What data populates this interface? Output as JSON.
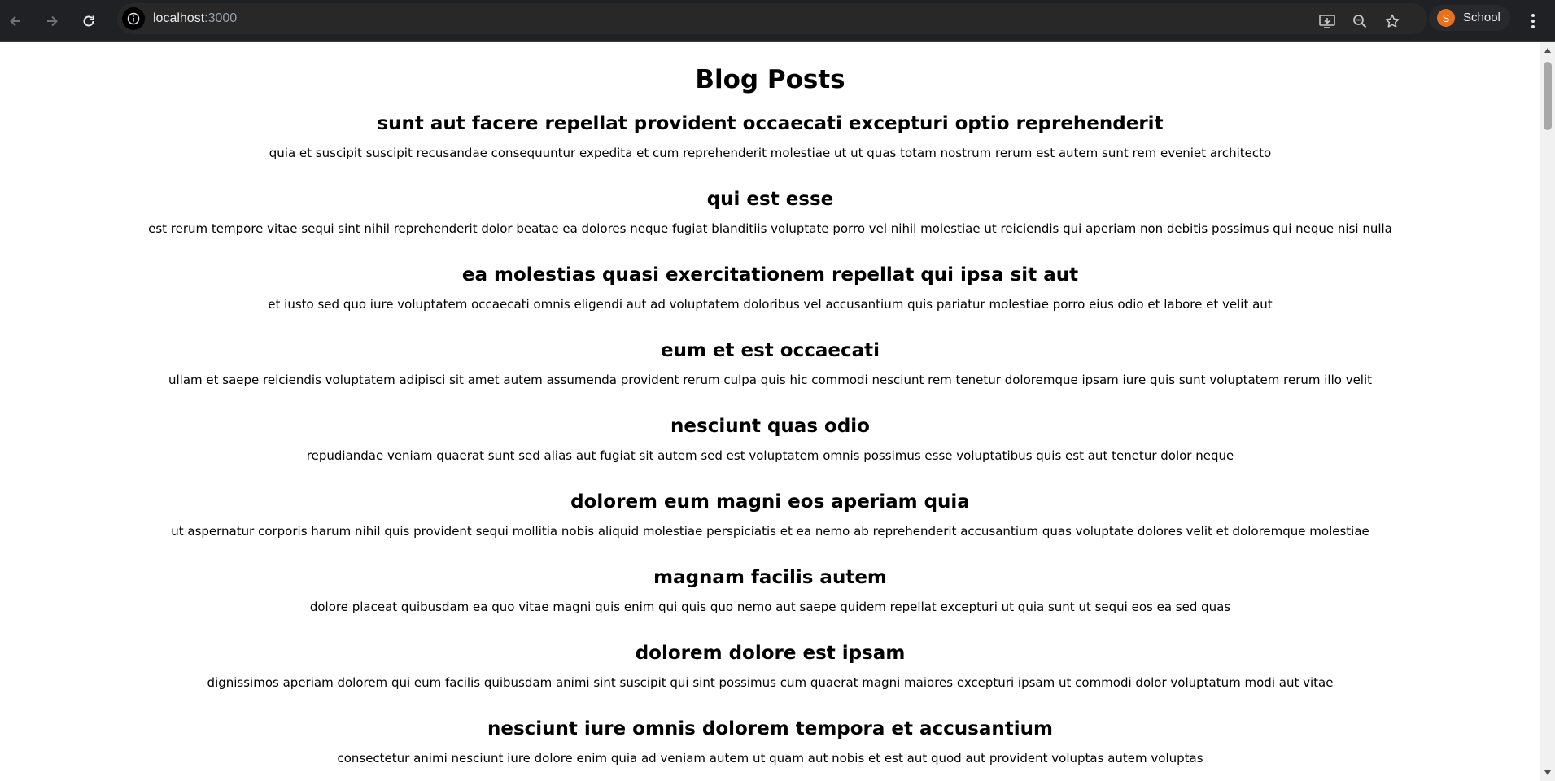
{
  "browser": {
    "url_host": "localhost",
    "url_port": ":3000",
    "profile_initial": "S",
    "profile_name": "School",
    "icons": [
      "back-arrow-icon",
      "forward-arrow-icon",
      "reload-icon",
      "site-info-icon",
      "install-app-icon",
      "zoom-icon",
      "bookmark-star-icon",
      "kebab-menu-icon"
    ]
  },
  "page": {
    "title": "Blog Posts",
    "posts": [
      {
        "title": "sunt aut facere repellat provident occaecati excepturi optio reprehenderit",
        "body": "quia et suscipit suscipit recusandae consequuntur expedita et cum reprehenderit molestiae ut ut quas totam nostrum rerum est autem sunt rem eveniet architecto"
      },
      {
        "title": "qui est esse",
        "body": "est rerum tempore vitae sequi sint nihil reprehenderit dolor beatae ea dolores neque fugiat blanditiis voluptate porro vel nihil molestiae ut reiciendis qui aperiam non debitis possimus qui neque nisi nulla"
      },
      {
        "title": "ea molestias quasi exercitationem repellat qui ipsa sit aut",
        "body": "et iusto sed quo iure voluptatem occaecati omnis eligendi aut ad voluptatem doloribus vel accusantium quis pariatur molestiae porro eius odio et labore et velit aut"
      },
      {
        "title": "eum et est occaecati",
        "body": "ullam et saepe reiciendis voluptatem adipisci sit amet autem assumenda provident rerum culpa quis hic commodi nesciunt rem tenetur doloremque ipsam iure quis sunt voluptatem rerum illo velit"
      },
      {
        "title": "nesciunt quas odio",
        "body": "repudiandae veniam quaerat sunt sed alias aut fugiat sit autem sed est voluptatem omnis possimus esse voluptatibus quis est aut tenetur dolor neque"
      },
      {
        "title": "dolorem eum magni eos aperiam quia",
        "body": "ut aspernatur corporis harum nihil quis provident sequi mollitia nobis aliquid molestiae perspiciatis et ea nemo ab reprehenderit accusantium quas voluptate dolores velit et doloremque molestiae"
      },
      {
        "title": "magnam facilis autem",
        "body": "dolore placeat quibusdam ea quo vitae magni quis enim qui quis quo nemo aut saepe quidem repellat excepturi ut quia sunt ut sequi eos ea sed quas"
      },
      {
        "title": "dolorem dolore est ipsam",
        "body": "dignissimos aperiam dolorem qui eum facilis quibusdam animi sint suscipit qui sint possimus cum quaerat magni maiores excepturi ipsam ut commodi dolor voluptatum modi aut vitae"
      },
      {
        "title": "nesciunt iure omnis dolorem tempora et accusantium",
        "body": "consectetur animi nesciunt iure dolore enim quia ad veniam autem ut quam aut nobis et est aut quod aut provident voluptas autem voluptas"
      }
    ]
  }
}
